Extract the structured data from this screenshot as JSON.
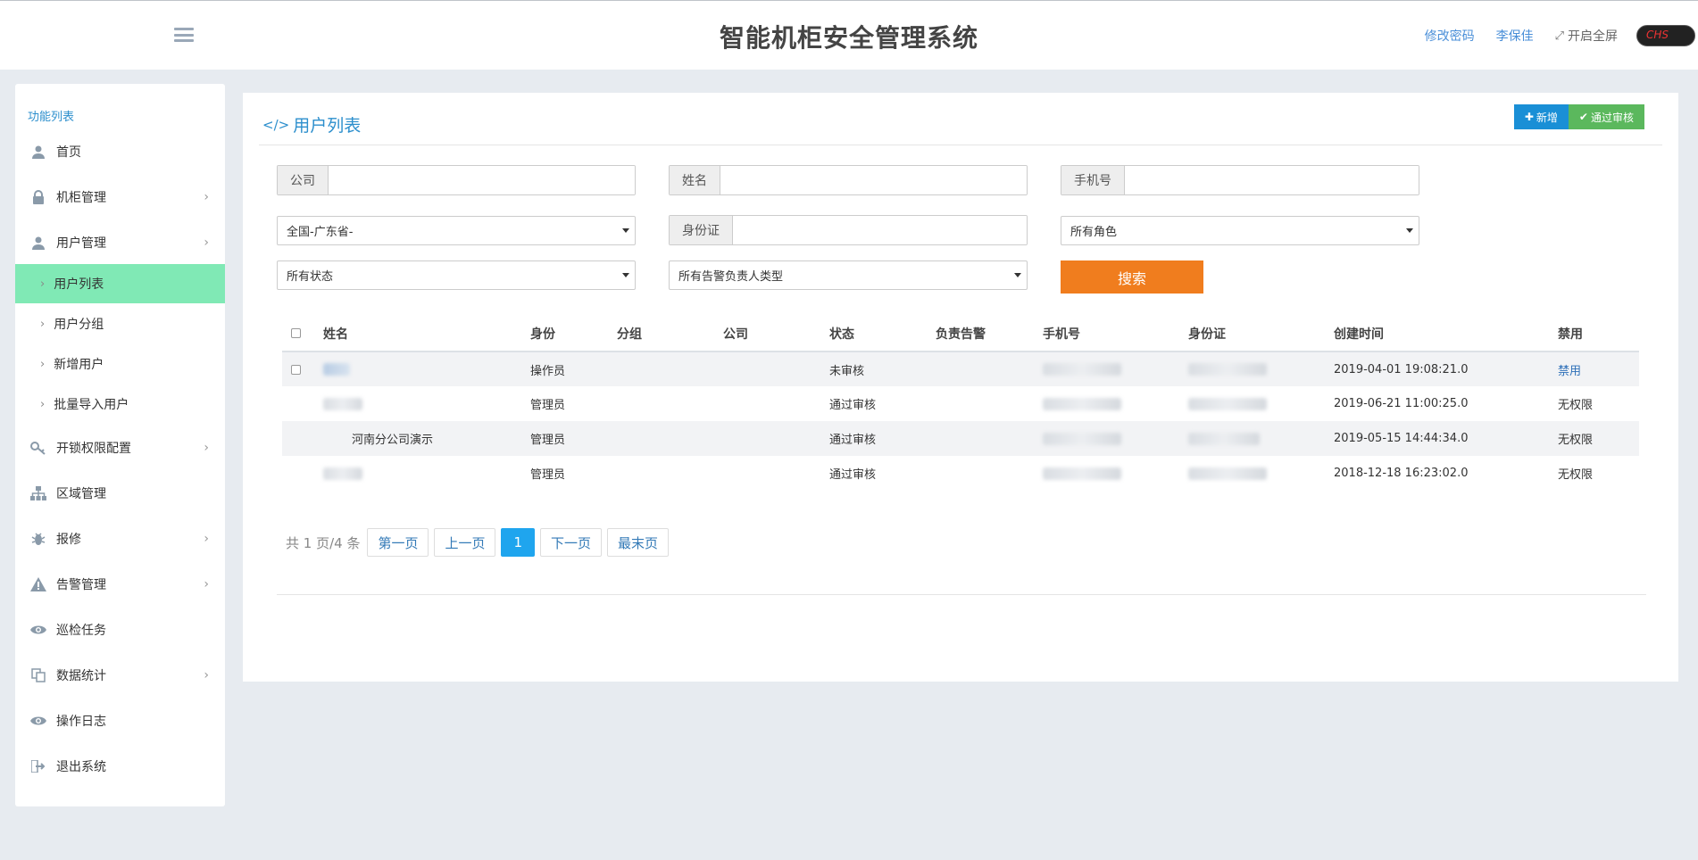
{
  "header": {
    "title": "智能机柜安全管理系统",
    "change_password": "修改密码",
    "username": "李保佳",
    "fullscreen": "开启全屏",
    "lang": "CHS"
  },
  "sidebar": {
    "title": "功能列表",
    "items": [
      {
        "label": "首页",
        "icon": "user-icon"
      },
      {
        "label": "机柜管理",
        "icon": "lock-icon"
      },
      {
        "label": "用户管理",
        "icon": "user-icon"
      },
      {
        "label": "开锁权限配置",
        "icon": "key-icon"
      },
      {
        "label": "区域管理",
        "icon": "sitemap-icon"
      },
      {
        "label": "报修",
        "icon": "bug-icon"
      },
      {
        "label": "告警管理",
        "icon": "warning-icon"
      },
      {
        "label": "巡检任务",
        "icon": "eye-icon"
      },
      {
        "label": "数据统计",
        "icon": "copy-icon"
      },
      {
        "label": "操作日志",
        "icon": "eye-icon"
      },
      {
        "label": "退出系统",
        "icon": "signout-icon"
      }
    ],
    "sub_items": [
      {
        "label": "用户列表",
        "active": true
      },
      {
        "label": "用户分组"
      },
      {
        "label": "新增用户"
      },
      {
        "label": "批量导入用户"
      }
    ]
  },
  "main": {
    "title": "用户列表",
    "add_button": "新增",
    "approve_button": "通过审核",
    "filters": {
      "company_label": "公司",
      "name_label": "姓名",
      "phone_label": "手机号",
      "region_value": "全国-广东省-",
      "idcard_label": "身份证",
      "role_value": "所有角色",
      "status_value": "所有状态",
      "alarm_type_value": "所有告警负责人类型",
      "search_button": "搜索"
    },
    "table": {
      "headers": [
        "姓名",
        "身份",
        "分组",
        "公司",
        "状态",
        "负责告警",
        "手机号",
        "身份证",
        "创建时间",
        "禁用"
      ],
      "rows": [
        {
          "name": "",
          "role": "操作员",
          "group": "",
          "company": "",
          "status": "未审核",
          "alarm": "",
          "created": "2019-04-01 19:08:21.0",
          "disable": "禁用",
          "checkbox": true
        },
        {
          "name": "",
          "role": "管理员",
          "group": "",
          "company": "",
          "status": "通过审核",
          "alarm": "",
          "created": "2019-06-21 11:00:25.0",
          "disable": "无权限",
          "checkbox": false
        },
        {
          "name": "河南分公司演示",
          "role": "管理员",
          "group": "",
          "company": "",
          "status": "通过审核",
          "alarm": "",
          "created": "2019-05-15 14:44:34.0",
          "disable": "无权限",
          "checkbox": false
        },
        {
          "name": "",
          "role": "管理员",
          "group": "",
          "company": "",
          "status": "通过审核",
          "alarm": "",
          "created": "2018-12-18 16:23:02.0",
          "disable": "无权限",
          "checkbox": false
        }
      ]
    },
    "pagination": {
      "info": "共 1 页/4 条",
      "first": "第一页",
      "prev": "上一页",
      "current": "1",
      "next": "下一页",
      "last": "最末页"
    }
  },
  "colors": {
    "accent": "#2d8fcd",
    "active_menu": "#80e9b5",
    "search": "#f07d1e",
    "add": "#1a8fd6",
    "approve": "#5bb85d"
  }
}
